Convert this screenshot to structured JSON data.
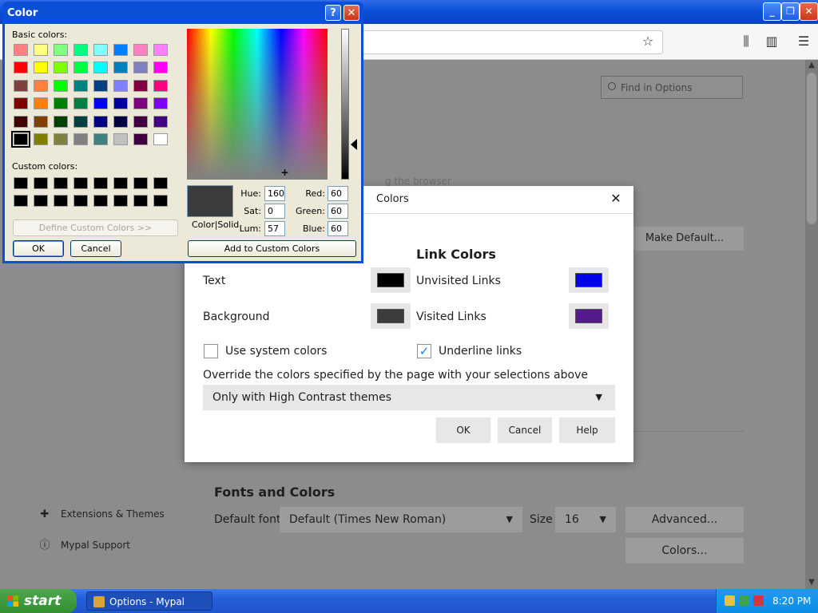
{
  "browser": {
    "find_placeholder": "Find in Options",
    "make_default": "Make Default...",
    "bg_faint_text": "g the browser",
    "sidebar": [
      {
        "label": "Extensions & Themes"
      },
      {
        "label": "Mypal Support"
      }
    ],
    "fonts": {
      "heading": "Fonts and Colors",
      "default_font_label": "Default font",
      "default_font_value": "Default (Times New Roman)",
      "size_label": "Size",
      "size_value": "16",
      "advanced_button": "Advanced...",
      "colors_button": "Colors..."
    }
  },
  "colors_dialog": {
    "title": "Colors",
    "link_colors_heading": "Link Colors",
    "text_label": "Text",
    "background_label": "Background",
    "unvisited_label": "Unvisited Links",
    "visited_label": "Visited Links",
    "use_system_colors": "Use system colors",
    "use_system_colors_checked": false,
    "underline_links": "Underline links",
    "underline_links_checked": true,
    "override_label": "Override the colors specified by the page with your selections above",
    "override_value": "Only with High Contrast themes",
    "ok": "OK",
    "cancel": "Cancel",
    "help": "Help",
    "swatches": {
      "text": "#000000",
      "background": "#3c3c3c",
      "unvisited": "#0000ee",
      "visited": "#551a8b"
    }
  },
  "color_picker": {
    "title": "Color",
    "basic_colors_label": "Basic colors:",
    "custom_colors_label": "Custom colors:",
    "define_custom": "Define Custom Colors >>",
    "ok": "OK",
    "cancel": "Cancel",
    "color_solid": "Color|Solid",
    "add_to_custom": "Add to Custom Colors",
    "hue_label": "Hue:",
    "hue": "160",
    "sat_label": "Sat:",
    "sat": "0",
    "lum_label": "Lum:",
    "lum": "57",
    "red_label": "Red:",
    "red": "60",
    "green_label": "Green:",
    "green": "60",
    "blue_label": "Blue:",
    "blue": "60",
    "basic_colors": [
      "#ff8080",
      "#ffff80",
      "#80ff80",
      "#00ff80",
      "#80ffff",
      "#0080ff",
      "#ff80c0",
      "#ff80ff",
      "#ff0000",
      "#ffff00",
      "#80ff00",
      "#00ff40",
      "#00ffff",
      "#0080c0",
      "#8080c0",
      "#ff00ff",
      "#804040",
      "#ff8040",
      "#00ff00",
      "#008080",
      "#004080",
      "#8080ff",
      "#800040",
      "#ff0080",
      "#800000",
      "#ff8000",
      "#008000",
      "#008040",
      "#0000ff",
      "#0000a0",
      "#800080",
      "#8000ff",
      "#400000",
      "#804000",
      "#004000",
      "#004040",
      "#000080",
      "#000040",
      "#400040",
      "#400080",
      "#000000",
      "#808000",
      "#808040",
      "#808080",
      "#408080",
      "#c0c0c0",
      "#400040",
      "#ffffff"
    ]
  },
  "taskbar": {
    "start": "start",
    "task": "Options - Mypal",
    "clock": "8:20 PM"
  }
}
